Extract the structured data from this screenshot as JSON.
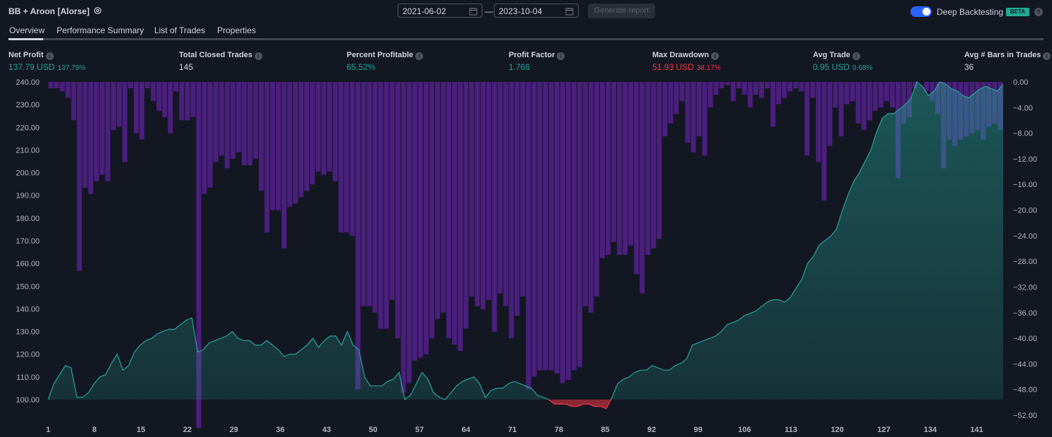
{
  "header": {
    "title": "BB + Aroon [Alorse]",
    "date_from": "2021-06-02",
    "date_separator": "—",
    "date_to": "2023-10-04",
    "generate_label": "Generate report",
    "deep_label": "Deep Backtesting",
    "beta_label": "BETA",
    "help_label": "?",
    "deep_enabled": true
  },
  "tabs": [
    {
      "label": "Overview",
      "active": true
    },
    {
      "label": "Performance Summary",
      "active": false
    },
    {
      "label": "List of Trades",
      "active": false
    },
    {
      "label": "Properties",
      "active": false
    }
  ],
  "metrics": [
    {
      "label": "Net Profit",
      "value": "137.79 USD",
      "sub": "137.79%",
      "color": "#26a69a"
    },
    {
      "label": "Total Closed Trades",
      "value": "145",
      "sub": "",
      "color": "#d1d4dc"
    },
    {
      "label": "Percent Profitable",
      "value": "65.52%",
      "sub": "",
      "color": "#26a69a"
    },
    {
      "label": "Profit Factor",
      "value": "1.766",
      "sub": "",
      "color": "#26a69a"
    },
    {
      "label": "Max Drawdown",
      "value": "51.93 USD",
      "sub": "38.17%",
      "color": "#f23645"
    },
    {
      "label": "Avg Trade",
      "value": "0.95 USD",
      "sub": "0.68%",
      "color": "#26a69a"
    },
    {
      "label": "Avg # Bars in Trades",
      "value": "36",
      "sub": "",
      "color": "#d1d4dc"
    }
  ],
  "colors": {
    "equity_up": "#26a69a",
    "equity_down": "#f23645",
    "drawdown_bars": "#4a1f7d",
    "background": "#131722"
  },
  "chart_data": {
    "type": "area",
    "x_ticks": [
      "1",
      "8",
      "15",
      "22",
      "29",
      "36",
      "43",
      "50",
      "57",
      "64",
      "71",
      "78",
      "85",
      "92",
      "99",
      "106",
      "113",
      "120",
      "127",
      "134",
      "141"
    ],
    "left_axis_ticks": [
      "240.00",
      "230.00",
      "220.00",
      "210.00",
      "200.00",
      "190.00",
      "180.00",
      "170.00",
      "160.00",
      "150.00",
      "140.00",
      "130.00",
      "120.00",
      "110.00",
      "100.00"
    ],
    "right_axis_ticks": [
      "0.00",
      "−4.00",
      "−8.00",
      "−12.00",
      "−16.00",
      "−20.00",
      "−24.00",
      "−28.00",
      "−32.00",
      "−36.00",
      "−40.00",
      "−44.00",
      "−48.00",
      "−52.00"
    ],
    "ylim_left": [
      100,
      240
    ],
    "ylim_right": [
      -52,
      0
    ],
    "x_range": [
      1,
      145
    ],
    "baseline": 100,
    "series": [
      {
        "name": "Equity",
        "type": "area",
        "axis": "left",
        "values": [
          100,
          107,
          111,
          115,
          114,
          101,
          101,
          103,
          107,
          110,
          111,
          116,
          120,
          113,
          115,
          121,
          124,
          126,
          127,
          129,
          130,
          131,
          131,
          133,
          135,
          136,
          121,
          122,
          125,
          126,
          127,
          128,
          130,
          127,
          126,
          126,
          124,
          124,
          126,
          124,
          122,
          119,
          120,
          120,
          122,
          124,
          127,
          123,
          126,
          128,
          128,
          124,
          130,
          124,
          122,
          110,
          106,
          106,
          106,
          108,
          109,
          112,
          100,
          102,
          107,
          112,
          109,
          103,
          101,
          100,
          103,
          106,
          108,
          109,
          110,
          107,
          101,
          104,
          105,
          105,
          107,
          108,
          107,
          106,
          105,
          102,
          101,
          100,
          98,
          98,
          98,
          97,
          97,
          98,
          98,
          97,
          97,
          96,
          101,
          107,
          109,
          110,
          112,
          113,
          113,
          115,
          114,
          113,
          113,
          115,
          116,
          118,
          124,
          125,
          126,
          127,
          128,
          130,
          133,
          134,
          135,
          137,
          138,
          139,
          141,
          143,
          144,
          144,
          143,
          145,
          149,
          153,
          160,
          163,
          168,
          170,
          172,
          175,
          183,
          190,
          196,
          200,
          205,
          210,
          218,
          224,
          226,
          226,
          228,
          230,
          233,
          240,
          238,
          234,
          236,
          240,
          239,
          237,
          236,
          234,
          233,
          235,
          237,
          238,
          237,
          236,
          239
        ]
      },
      {
        "name": "Drawdown",
        "type": "bar",
        "axis": "right",
        "values": [
          -1.0,
          -1.0,
          -1.5,
          -2.5,
          -6.0,
          -29.5,
          -16.5,
          -17.5,
          -15.5,
          -14.5,
          -15.5,
          -7.5,
          -7.0,
          -12.5,
          -1.0,
          -8.0,
          -9.0,
          -1.0,
          -3.0,
          -4.5,
          -5.5,
          -8.0,
          -1.5,
          -6.0,
          -6.0,
          -5.5,
          -54.0,
          -17.5,
          -16.5,
          -12.5,
          -11.5,
          -13.5,
          -12.0,
          -11.0,
          -13.0,
          -13.0,
          -12.0,
          -17.0,
          -23.5,
          -20.0,
          -20.0,
          -26.0,
          -19.5,
          -19.0,
          -18.0,
          -17.0,
          -16.0,
          -14.0,
          -14.5,
          -14.0,
          -15.5,
          -23.5,
          -23.5,
          -24.0,
          -48.0,
          -35.0,
          -35.0,
          -36.0,
          -38.5,
          -38.5,
          -34.0,
          -40.0,
          -48.5,
          -47.0,
          -43.5,
          -43.0,
          -42.5,
          -40.0,
          -37.0,
          -36.0,
          -40.0,
          -41.0,
          -42.0,
          -38.5,
          -33.5,
          -35.0,
          -35.5,
          -34.0,
          -39.0,
          -33.0,
          -35.0,
          -40.0,
          -36.5,
          -33.5,
          -48.0,
          -46.0,
          -45.0,
          -45.0,
          -45.0,
          -45.5,
          -47.0,
          -46.5,
          -45.0,
          -44.5,
          -35.0,
          -36.0,
          -33.5,
          -27.5,
          -27.0,
          -25.0,
          -27.0,
          -27.0,
          -25.5,
          -30.0,
          -33.0,
          -27.0,
          -26.0,
          -24.5,
          -8.5,
          -6.5,
          -5.0,
          -3.0,
          -9.5,
          -11.0,
          -8.5,
          -11.5,
          -4.0,
          -2.0,
          -1.0,
          -0.5,
          -3.0,
          -1.0,
          -2.0,
          -4.0,
          -2.0,
          -2.5,
          -1.0,
          -7.0,
          -3.5,
          -2.5,
          -1.5,
          -1.0,
          -1.5,
          -11.5,
          -2.5,
          -12.5,
          -18.5,
          -10.0,
          -4.0,
          -8.5,
          -3.5,
          -3.0,
          -6.5,
          -7.5,
          -6.0,
          -4.5,
          -4.0,
          -3.0,
          -4.0,
          -15.0,
          -6.5,
          -5.5,
          -1.0,
          0.0,
          -1.5,
          -3.0,
          -5.0,
          -13.5,
          -9.0,
          -10.0,
          -9.0,
          -8.5,
          -8.0,
          -7.5,
          -9.0,
          -7.0,
          -6.5,
          -7.5
        ]
      }
    ],
    "legend": "none",
    "grid": false
  }
}
